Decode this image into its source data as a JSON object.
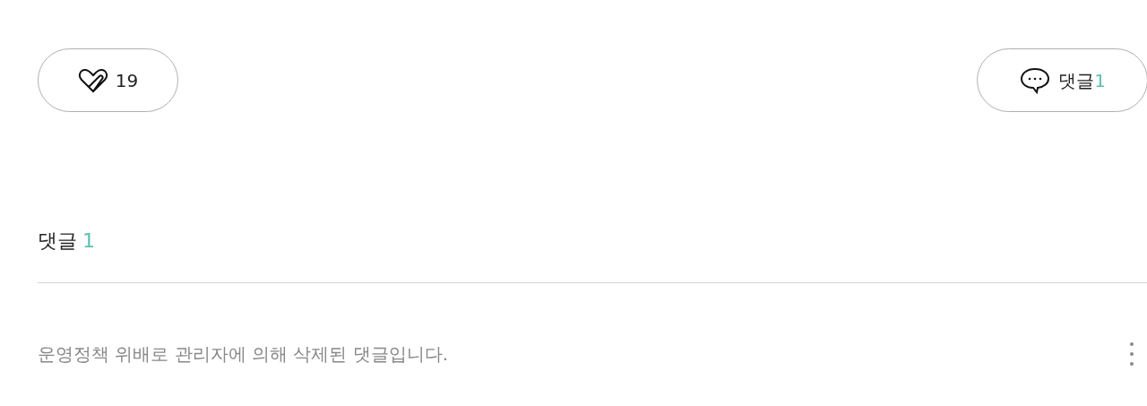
{
  "like_button": {
    "count": "19"
  },
  "comment_button": {
    "label": "댓글",
    "count": "1"
  },
  "comments_header": {
    "label": "댓글",
    "count": "1"
  },
  "comments": [
    {
      "text": "운영정책 위배로 관리자에 의해 삭제된 댓글입니다."
    }
  ]
}
